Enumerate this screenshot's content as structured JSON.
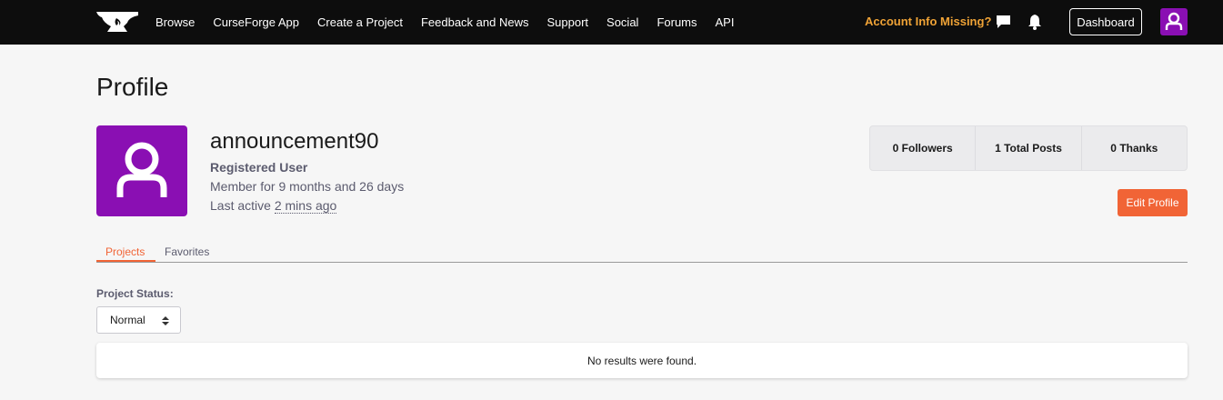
{
  "nav": {
    "items": [
      "Browse",
      "CurseForge App",
      "Create a Project",
      "Feedback and News",
      "Support",
      "Social",
      "Forums",
      "API"
    ],
    "account_warning": "Account Info Missing?",
    "dashboard_label": "Dashboard"
  },
  "page": {
    "title": "Profile"
  },
  "profile": {
    "username": "announcement90",
    "role": "Registered User",
    "member_for": "Member for 9 months and 26 days",
    "last_active_prefix": "Last active",
    "last_active_ago": "2 mins ago"
  },
  "stats": {
    "followers_count": "0",
    "followers_label": "Followers",
    "posts_count": "1",
    "posts_label": "Total Posts",
    "thanks_count": "0",
    "thanks_label": "Thanks"
  },
  "edit_profile_label": "Edit Profile",
  "tabs": [
    {
      "label": "Projects",
      "active": true
    },
    {
      "label": "Favorites",
      "active": false
    }
  ],
  "filter": {
    "label": "Project Status:",
    "selected": "Normal"
  },
  "results": {
    "empty_message": "No results were found."
  },
  "colors": {
    "accent": "#f16436",
    "avatar_bg": "#8a0fb3",
    "warning": "#f0a336",
    "topbar": "#0d0d0d"
  }
}
